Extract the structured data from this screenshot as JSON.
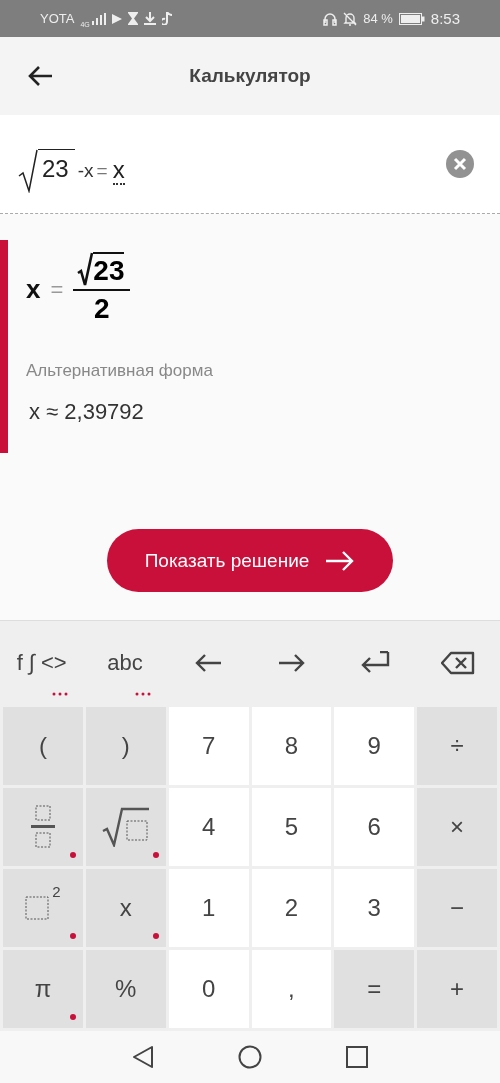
{
  "status_bar": {
    "carrier": "YOTA",
    "network": "4G",
    "battery": "84 %",
    "time": "8:53"
  },
  "app_bar": {
    "title": "Калькулятор"
  },
  "input": {
    "radicand": "23",
    "rest": "-x",
    "equals": "=",
    "rhs": "x"
  },
  "result": {
    "variable": "x",
    "equals": "=",
    "numerator_radicand": "23",
    "denominator": "2",
    "alt_label": "Альтернативная форма",
    "alt_value": "x ≈ 2,39792"
  },
  "solution_button": {
    "label": "Показать решение"
  },
  "toolbar": [
    {
      "kind": "text",
      "label": "f ∫ <>",
      "more": true
    },
    {
      "kind": "text",
      "label": "abc",
      "more": true
    },
    {
      "kind": "left",
      "more": false
    },
    {
      "kind": "right",
      "more": false
    },
    {
      "kind": "enter",
      "more": false
    },
    {
      "kind": "backspace",
      "more": false
    }
  ],
  "keys": [
    {
      "kind": "text",
      "label": "(",
      "shaded": true,
      "more": false
    },
    {
      "kind": "text",
      "label": ")",
      "shaded": true,
      "more": false
    },
    {
      "kind": "text",
      "label": "7",
      "shaded": false,
      "more": false
    },
    {
      "kind": "text",
      "label": "8",
      "shaded": false,
      "more": false
    },
    {
      "kind": "text",
      "label": "9",
      "shaded": false,
      "more": false
    },
    {
      "kind": "text",
      "label": "÷",
      "shaded": true,
      "more": false
    },
    {
      "kind": "fraction",
      "shaded": true,
      "more": true
    },
    {
      "kind": "sqrt",
      "shaded": true,
      "more": true
    },
    {
      "kind": "text",
      "label": "4",
      "shaded": false,
      "more": false
    },
    {
      "kind": "text",
      "label": "5",
      "shaded": false,
      "more": false
    },
    {
      "kind": "text",
      "label": "6",
      "shaded": false,
      "more": false
    },
    {
      "kind": "text",
      "label": "×",
      "shaded": true,
      "more": false
    },
    {
      "kind": "power",
      "label": "2",
      "shaded": true,
      "more": true
    },
    {
      "kind": "text",
      "label": "x",
      "shaded": true,
      "more": true
    },
    {
      "kind": "text",
      "label": "1",
      "shaded": false,
      "more": false
    },
    {
      "kind": "text",
      "label": "2",
      "shaded": false,
      "more": false
    },
    {
      "kind": "text",
      "label": "3",
      "shaded": false,
      "more": false
    },
    {
      "kind": "text",
      "label": "−",
      "shaded": true,
      "more": false
    },
    {
      "kind": "text",
      "label": "π",
      "shaded": true,
      "more": true
    },
    {
      "kind": "text",
      "label": "%",
      "shaded": true,
      "more": false
    },
    {
      "kind": "text",
      "label": "0",
      "shaded": false,
      "more": false
    },
    {
      "kind": "text",
      "label": ",",
      "shaded": false,
      "more": false
    },
    {
      "kind": "text",
      "label": "=",
      "shaded": true,
      "more": false
    },
    {
      "kind": "text",
      "label": "+",
      "shaded": true,
      "more": false
    }
  ]
}
